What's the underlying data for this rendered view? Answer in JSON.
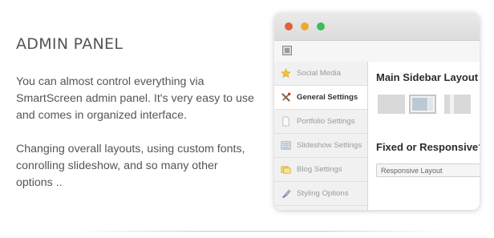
{
  "intro": {
    "heading": "ADMIN PANEL",
    "paragraph1": "You can almost control everything via SmartScreen admin panel. It's very easy to use and comes in organized interface.",
    "paragraph2": "Changing overall layouts, using custom fonts, conrolling slideshow, and so many other options .."
  },
  "window": {
    "traffic_lights": [
      "#e0613d",
      "#f0a830",
      "#3dbc5c"
    ],
    "toolbar_icon": "save-icon"
  },
  "sidebar": {
    "items": [
      {
        "label": "Social Media",
        "icon": "star-icon",
        "active": false
      },
      {
        "label": "General Settings",
        "icon": "tools-icon",
        "active": true
      },
      {
        "label": "Portfolio Settings",
        "icon": "document-icon",
        "active": false
      },
      {
        "label": "Slideshow Settings",
        "icon": "slideshow-icon",
        "active": false
      },
      {
        "label": "Blog Settings",
        "icon": "blog-icon",
        "active": false
      },
      {
        "label": "Styling Options",
        "icon": "brush-icon",
        "active": false
      }
    ]
  },
  "content": {
    "layout_title": "Main Sidebar Layout",
    "layout_options": [
      "full-width",
      "sidebar-right",
      "sidebar-left"
    ],
    "layout_selected": "sidebar-right",
    "responsive_title": "Fixed or Responsive?",
    "responsive_value": "Responsive Layout"
  }
}
